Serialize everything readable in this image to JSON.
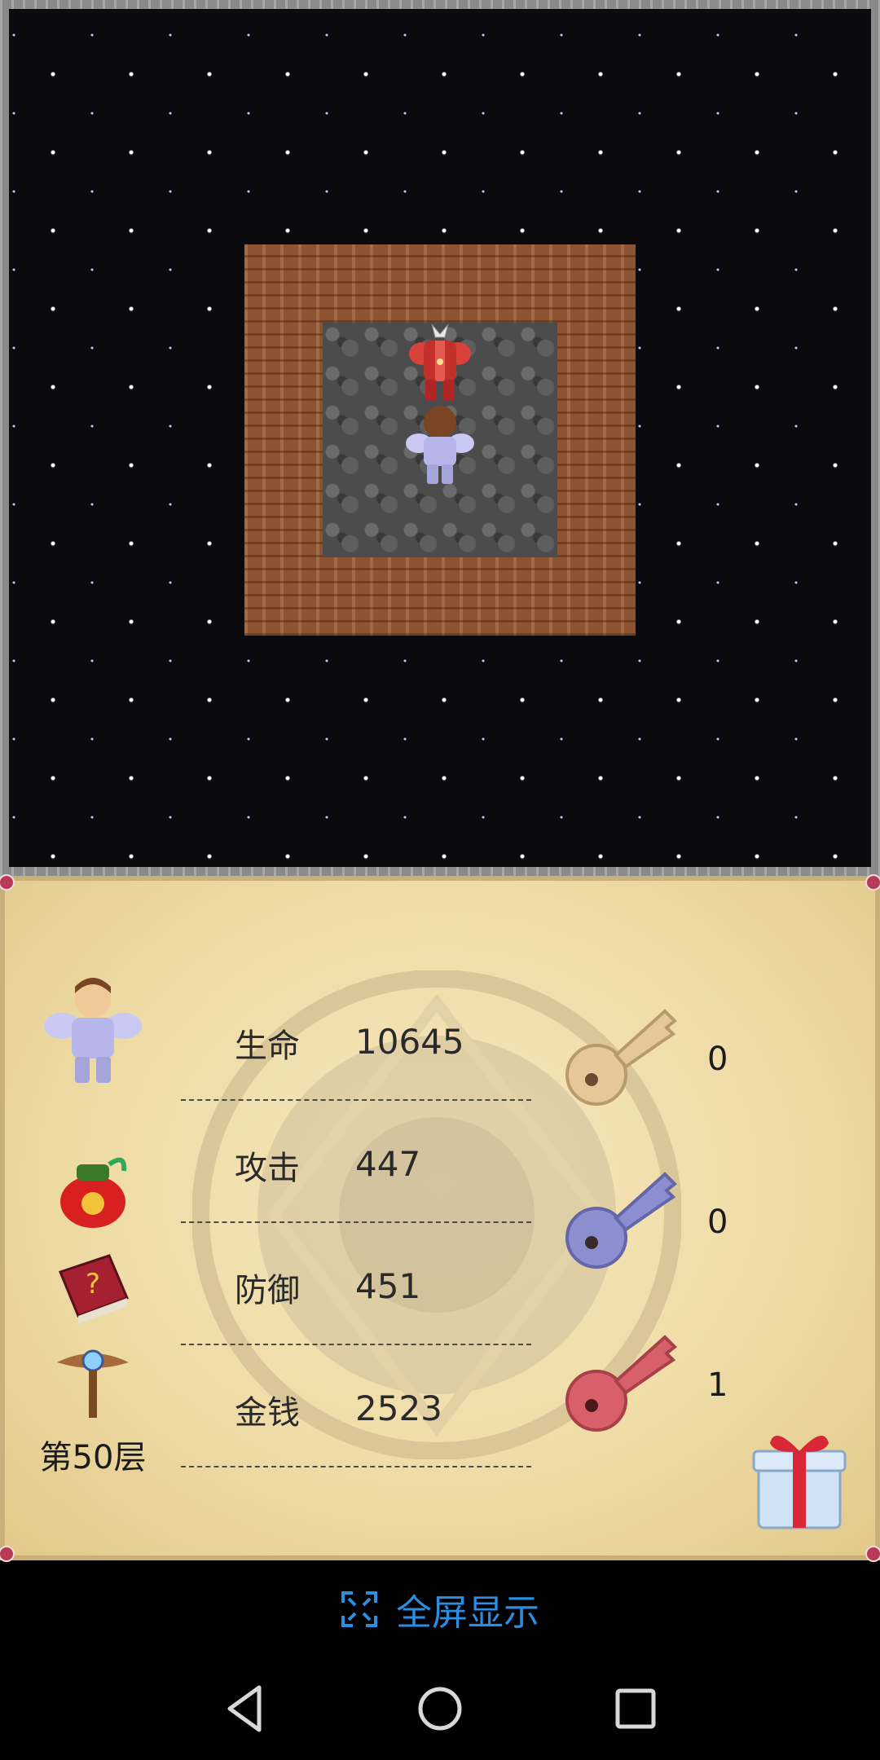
{
  "status": {
    "floor": "第50层",
    "stats": [
      {
        "label": "生命",
        "value": "10645"
      },
      {
        "label": "攻击",
        "value": "447"
      },
      {
        "label": "防御",
        "value": "451"
      },
      {
        "label": "金钱",
        "value": "2523"
      }
    ],
    "keys": [
      {
        "color": "yellow",
        "hex": "#e6c79a",
        "count": "0"
      },
      {
        "color": "blue",
        "hex": "#8c8fcf",
        "count": "0"
      },
      {
        "color": "red",
        "hex": "#d8606a",
        "count": "1"
      }
    ]
  },
  "fullscreen": {
    "label": "全屏显示",
    "icon": "fullscreen-icon"
  },
  "icons": {
    "hero": "hero-portrait-icon",
    "bag": "lucky-bag-icon",
    "book": "monster-book-icon",
    "wand": "fly-wand-icon",
    "gift": "gift-icon"
  },
  "colors": {
    "accent": "#2c8ee0",
    "panel": "#e9d7a3",
    "dirt": "#8e5431",
    "floor": "#4c4c4c"
  }
}
